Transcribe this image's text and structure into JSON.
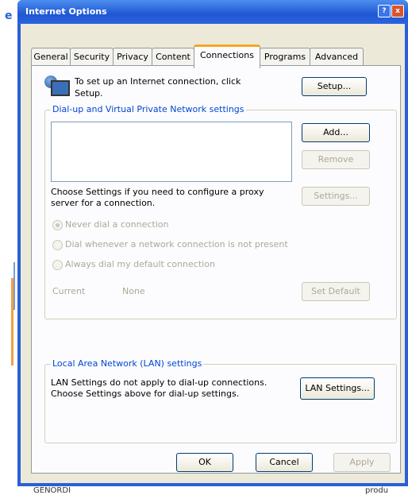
{
  "window": {
    "title": "Internet Options",
    "help": "?",
    "close": "x",
    "app_icon": "e"
  },
  "tabs": [
    "General",
    "Security",
    "Privacy",
    "Content",
    "Connections",
    "Programs",
    "Advanced"
  ],
  "active_tab": "Connections",
  "setup": {
    "text": "To set up an Internet connection, click Setup.",
    "button": "Setup..."
  },
  "dialup": {
    "group_label": "Dial-up and Virtual Private Network settings",
    "add": "Add...",
    "remove": "Remove",
    "proxy_text": "Choose Settings if you need to configure a proxy server for a connection.",
    "settings": "Settings...",
    "radios": [
      {
        "label": "Never dial a connection",
        "selected": true
      },
      {
        "label": "Dial whenever a network connection is not present",
        "selected": false
      },
      {
        "label": "Always dial my default connection",
        "selected": false
      }
    ],
    "current_label": "Current",
    "current_value": "None",
    "set_default": "Set Default"
  },
  "lan": {
    "group_label": "Local Area Network (LAN) settings",
    "text": "LAN Settings do not apply to dial-up connections. Choose Settings above for dial-up settings.",
    "button": "LAN Settings..."
  },
  "footer": {
    "ok": "OK",
    "cancel": "Cancel",
    "apply": "Apply"
  },
  "background": {
    "left_text": "GENORDI",
    "right_text": "produ"
  }
}
